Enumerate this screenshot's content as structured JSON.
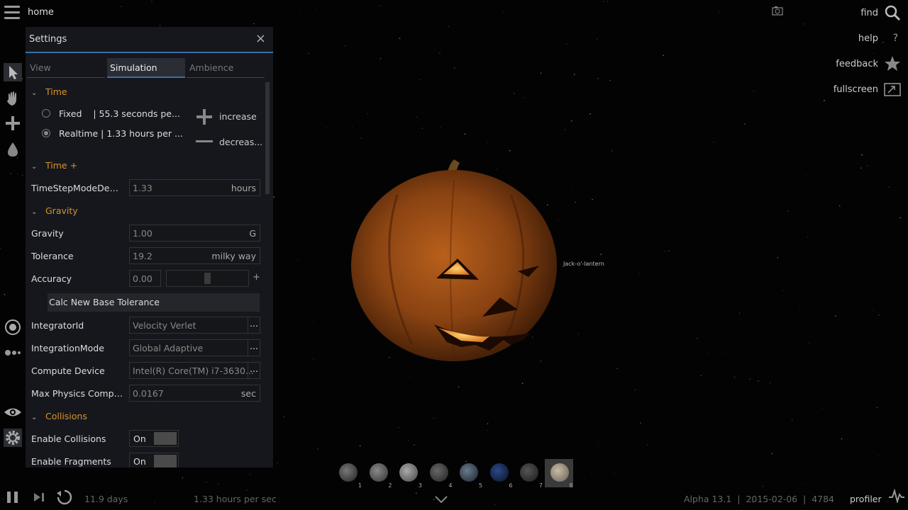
{
  "topbar": {
    "home": "home",
    "find": "find",
    "help": "help",
    "help_glyph": "?",
    "feedback": "feedback",
    "fullscreen": "fullscreen"
  },
  "left_ghost": {
    "select": "select",
    "move": "rub",
    "add": "add",
    "powers": "powers",
    "view": "view"
  },
  "settings": {
    "title": "Settings",
    "close": "×",
    "tabs": [
      "View",
      "Simulation",
      "Ambience"
    ],
    "active_tab": "Simulation",
    "time": {
      "header": "Time",
      "fixed_label": "Fixed",
      "fixed_value": "| 55.3 seconds pe...",
      "realtime_label": "Realtime | 1.33 hours per ...",
      "selected": "Realtime",
      "increase": "increase",
      "decrease": "decreas..."
    },
    "time_plus": {
      "header": "Time +",
      "label": "TimeStepModeDepe...",
      "value": "1.33",
      "unit": "hours"
    },
    "gravity": {
      "header": "Gravity",
      "gravity_label": "Gravity",
      "gravity_value": "1.00",
      "gravity_unit": "G",
      "tolerance_label": "Tolerance",
      "tolerance_value": "19.2",
      "tolerance_unit": "milky way",
      "accuracy_label": "Accuracy",
      "accuracy_value": "0.00",
      "accuracy_plus": "+",
      "calc_button": "Calc New Base Tolerance",
      "integrator_label": "IntegratorId",
      "integrator_value": "Velocity Verlet",
      "mode_label": "IntegrationMode",
      "mode_value": "Global Adaptive",
      "device_label": "Compute Device",
      "device_value": "Intel(R) Core(TM) i7-3630...",
      "maxphys_label": "Max Physics Comput...",
      "maxphys_value": "0.0167",
      "maxphys_unit": "sec",
      "dots": "..."
    },
    "collisions": {
      "header": "Collisions",
      "enable_collisions_label": "Enable Collisions",
      "enable_collisions_value": "On",
      "enable_fragments_label": "Enable Fragments",
      "enable_fragments_value": "On"
    }
  },
  "scene": {
    "object_label": "Jack-o'-lantern"
  },
  "thumbnails": [
    "1",
    "2",
    "3",
    "4",
    "5",
    "6",
    "7",
    "8"
  ],
  "bottom": {
    "elapsed": "11.9 days",
    "rate": "1.33 hours per sec",
    "version": "Alpha 13.1  |  2015-02-06  |  4784",
    "profiler": "profiler"
  },
  "colors": {
    "accent": "#3d6fa5",
    "section": "#d9942a",
    "panel": "#16181e"
  }
}
